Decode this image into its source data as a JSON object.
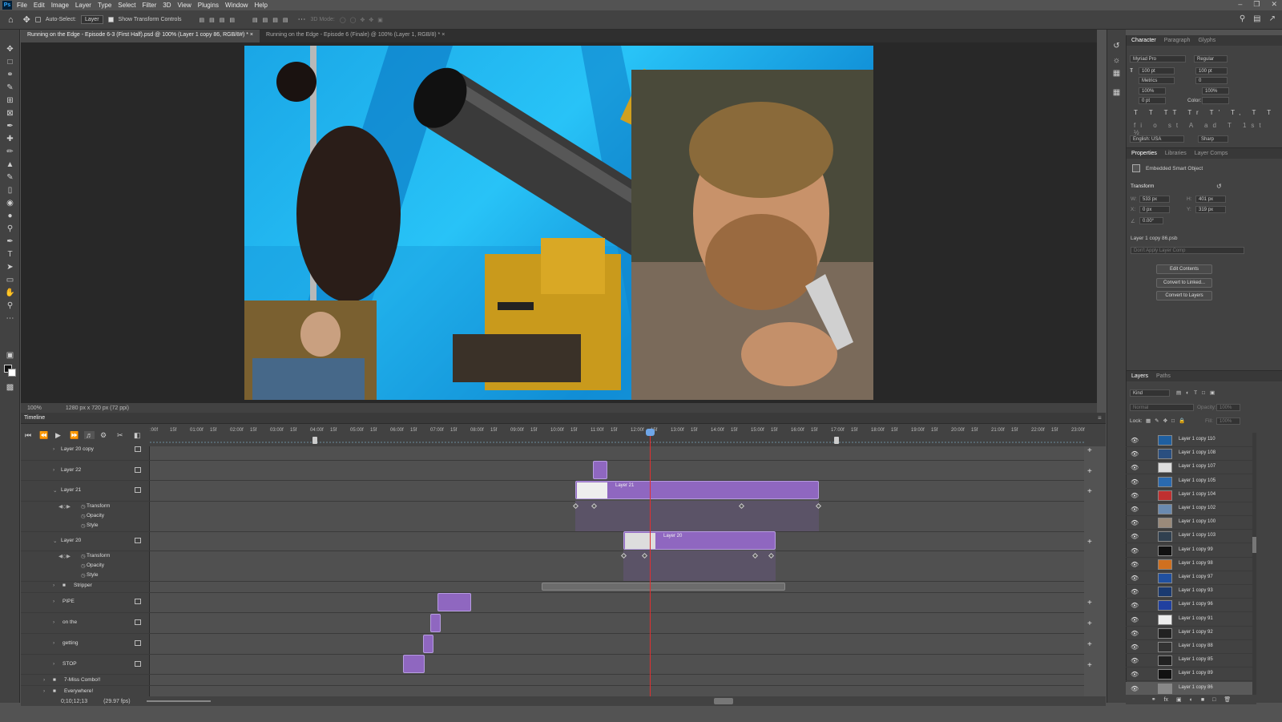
{
  "app": {
    "logo": "Ps"
  },
  "menu": [
    "File",
    "Edit",
    "Image",
    "Layer",
    "Type",
    "Select",
    "Filter",
    "3D",
    "View",
    "Plugins",
    "Window",
    "Help"
  ],
  "options": {
    "auto_select": "Auto-Select:",
    "layer_dropdown": "Layer",
    "show_transform": "Show Transform Controls",
    "mode3d": "3D Mode:"
  },
  "tabs": [
    {
      "label": "Running on the Edge - Episode 6-3 (First Half).psd @ 100% (Layer 1 copy 86, RGB/8#) *"
    },
    {
      "label": "Running on the Edge - Episode 6 (Finale) @ 100% (Layer 1, RGB/8) *"
    }
  ],
  "doc_status": {
    "zoom": "100%",
    "size": "1280 px x 720 px (72 ppi)"
  },
  "timeline": {
    "title": "Timeline",
    "ruler": [
      ":00f",
      "15f",
      "01:00f",
      "15f",
      "02:00f",
      "15f",
      "03:00f",
      "15f",
      "04:00f",
      "15f",
      "05:00f",
      "15f",
      "06:00f",
      "15f",
      "07:00f",
      "15f",
      "08:00f",
      "15f",
      "09:00f",
      "15f",
      "10:00f",
      "15f",
      "11:00f",
      "15f",
      "12:00f",
      "15f",
      "13:00f",
      "15f",
      "14:00f",
      "15f",
      "15:00f",
      "15f",
      "16:00f",
      "15f",
      "17:00f",
      "15f",
      "18:00f",
      "15f",
      "19:00f",
      "15f",
      "20:00f",
      "15f",
      "21:00f",
      "15f",
      "22:00f",
      "15f",
      "23:00f"
    ],
    "layers": [
      "Layer 20 copy",
      "Layer 22",
      "Layer 21",
      "Transform",
      "Opacity",
      "Style",
      "Layer 20",
      "Transform",
      "Opacity",
      "Style",
      "Stripper",
      "PIPE",
      "on the",
      "getting",
      "STOP",
      "7-Miss Combo!!",
      "Everywhere!"
    ],
    "clip_labels": {
      "layer21": "Layer 21",
      "layer20": "Layer 20"
    },
    "status": {
      "timecode": "0;10;12;13",
      "fps": "(29.97 fps)"
    }
  },
  "character": {
    "tabs": [
      "Character",
      "Paragraph",
      "Glyphs"
    ],
    "font": "Myriad Pro",
    "style": "Regular",
    "size": "100 pt",
    "leading": "100 pt",
    "kerning": "Metrics",
    "tracking": "0",
    "vscale": "100%",
    "hscale": "100%",
    "baseline": "0 pt",
    "color_label": "Color:",
    "language": "English: USA",
    "aa": "Sharp"
  },
  "properties": {
    "tabs": [
      "Properties",
      "Libraries",
      "Layer Comps"
    ],
    "type": "Embedded Smart Object",
    "transform": "Transform",
    "w": "533 px",
    "h": "401 px",
    "x": "0 px",
    "y": "319 px",
    "angle": "0.00°",
    "file": "Layer 1 copy 86.psb",
    "comp": "Don't Apply Layer Comp",
    "buttons": [
      "Edit Contents",
      "Convert to Linked...",
      "Convert to Layers"
    ]
  },
  "layers_panel": {
    "tabs": [
      "Layers",
      "Paths"
    ],
    "kind": "Kind",
    "blend": "Normal",
    "opacity_label": "Opacity:",
    "opacity": "100%",
    "lock_label": "Lock:",
    "fill_label": "Fill:",
    "fill": "100%",
    "items": [
      "Layer 1 copy 110",
      "Layer 1 copy 108",
      "Layer 1 copy 107",
      "Layer 1 copy 105",
      "Layer 1 copy 104",
      "Layer 1 copy 102",
      "Layer 1 copy 100",
      "Layer 1 copy 103",
      "Layer 1 copy 99",
      "Layer 1 copy 98",
      "Layer 1 copy 97",
      "Layer 1 copy 93",
      "Layer 1 copy 96",
      "Layer 1 copy 91",
      "Layer 1 copy 92",
      "Layer 1 copy 88",
      "Layer 1 copy 85",
      "Layer 1 copy 89",
      "Layer 1 copy 86"
    ]
  },
  "colors": {
    "clip": "#8f67c0",
    "playhead": "#e03030",
    "accent": "#31a8ff"
  }
}
